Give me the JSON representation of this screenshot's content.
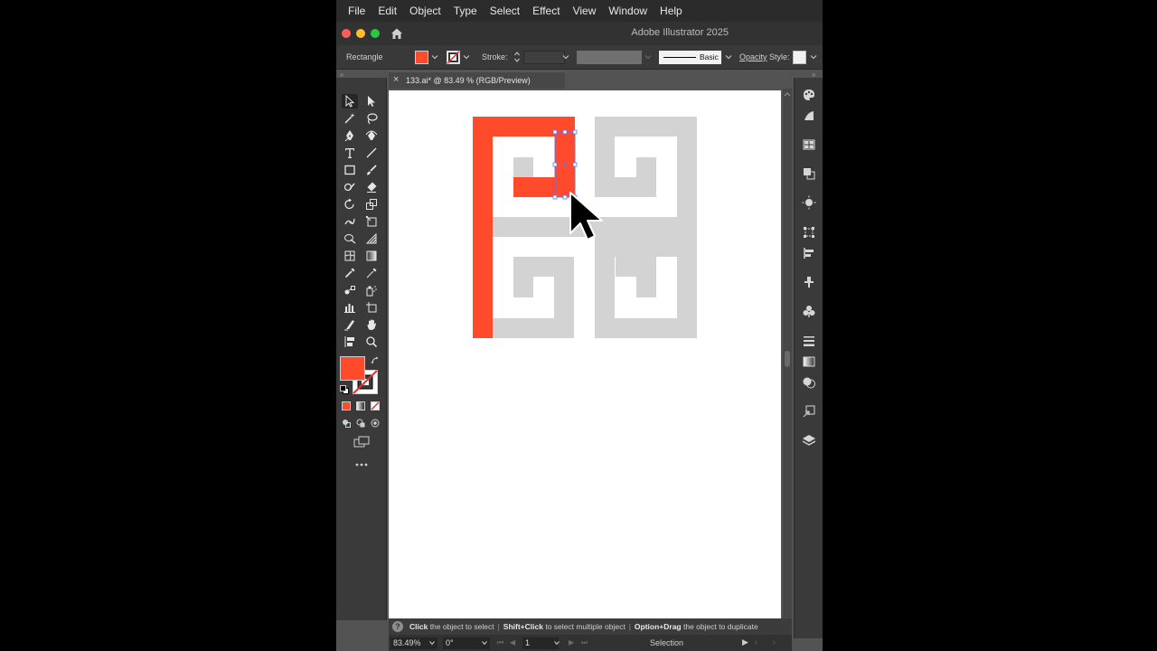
{
  "menubar": {
    "items": [
      "File",
      "Edit",
      "Object",
      "Type",
      "Select",
      "Effect",
      "View",
      "Window",
      "Help"
    ]
  },
  "titlebar": {
    "app_title": "Adobe Illustrator 2025"
  },
  "controlbar": {
    "selection_type": "Rectangle",
    "stroke_label": "Stroke:",
    "brush_label": "Basic",
    "opacity_label": "Opacity",
    "style_label": "Style:"
  },
  "document_tab": {
    "close": "×",
    "label": "133.ai* @ 83.49 % (RGB/Preview)"
  },
  "hint": {
    "icon": "?",
    "part1_bold": "Click",
    "part1": " the object to select",
    "part2_bold": "Shift+Click",
    "part2": " to select multiple object",
    "part3_bold": "Option+Drag",
    "part3": " the object to duplicate",
    "separator": "|"
  },
  "bottombar": {
    "zoom": "83.49%",
    "rotation": "0°",
    "artboard": "1",
    "status": "Selection"
  },
  "colors": {
    "fill_red": "#ff4b2b",
    "art_gray": "#d3d3d3",
    "selection_blue": "#5a73ff",
    "panel_dark": "#3a3a3a",
    "menubar_bg": "#2b2b2b"
  },
  "icons": {
    "home": "home-icon",
    "selection": "selection-tool-icon",
    "direct_selection": "direct-selection-tool-icon",
    "cursor": "mouse-pointer-icon"
  }
}
